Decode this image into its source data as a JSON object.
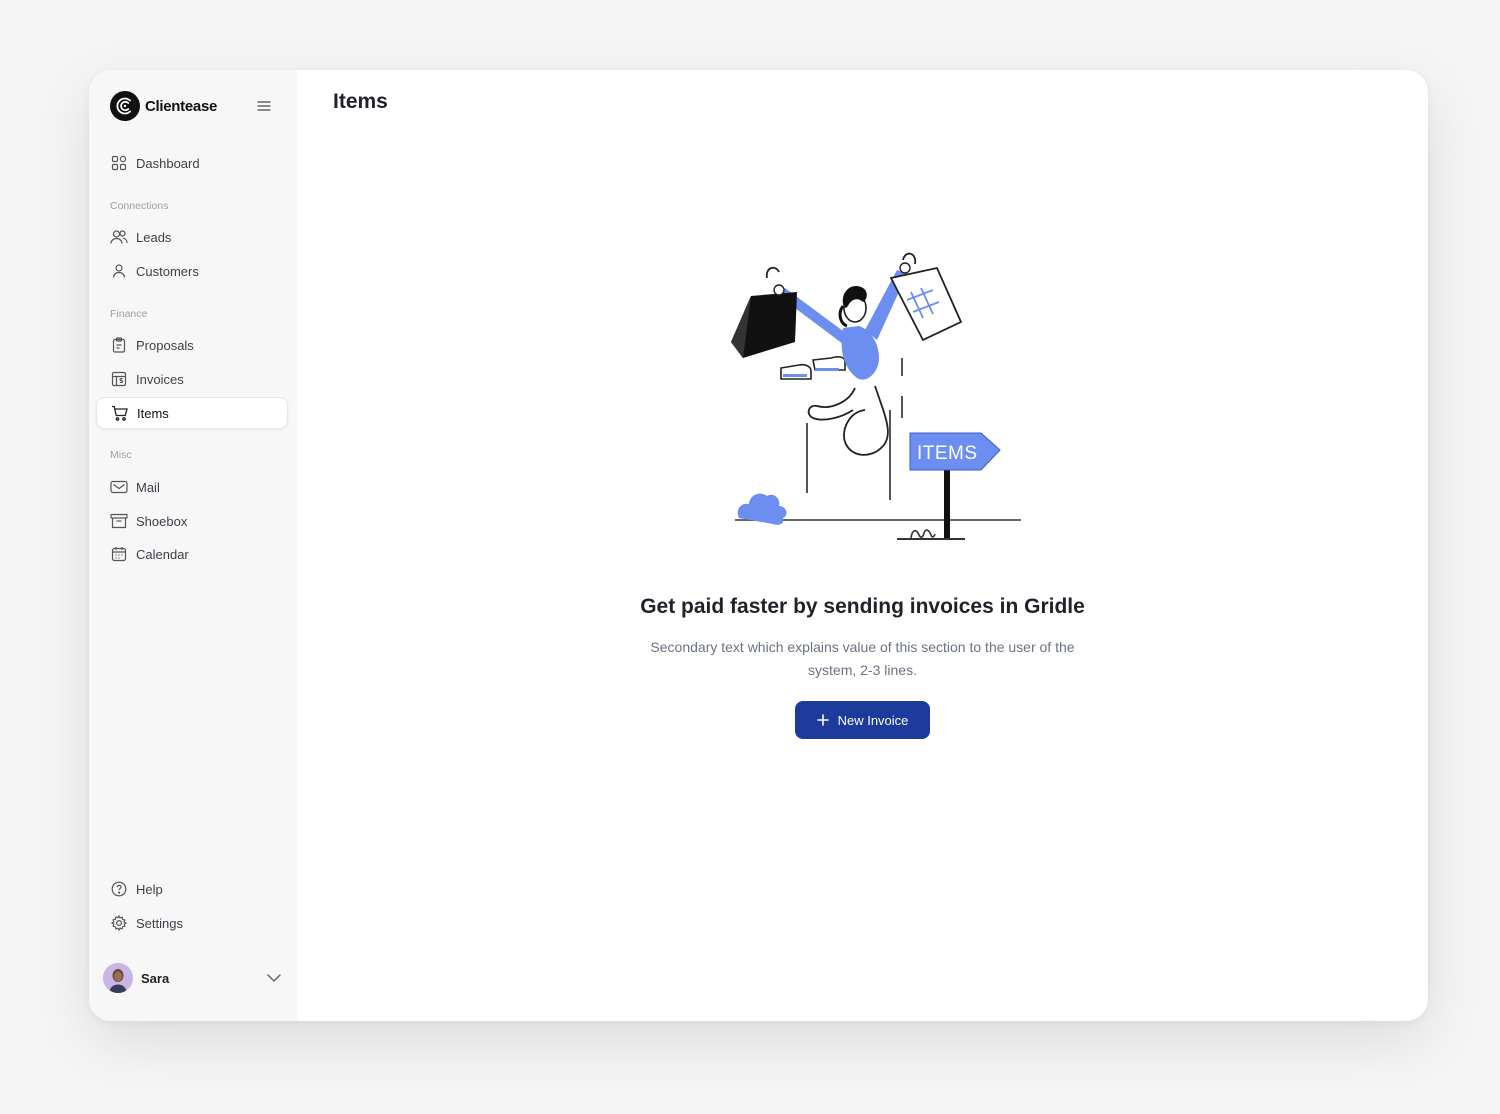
{
  "brand": {
    "name": "Clientease"
  },
  "sidebar": {
    "top_items": [
      {
        "label": "Dashboard",
        "icon": "grid-icon"
      }
    ],
    "sections": [
      {
        "label": "Connections",
        "items": [
          {
            "label": "Leads",
            "icon": "users-icon"
          },
          {
            "label": "Customers",
            "icon": "user-icon"
          }
        ]
      },
      {
        "label": "Finance",
        "items": [
          {
            "label": "Proposals",
            "icon": "clipboard-icon"
          },
          {
            "label": "Invoices",
            "icon": "invoice-icon"
          },
          {
            "label": "Items",
            "icon": "cart-icon",
            "active": true
          }
        ]
      },
      {
        "label": "Misc",
        "items": [
          {
            "label": "Mail",
            "icon": "mail-icon"
          },
          {
            "label": "Shoebox",
            "icon": "archive-icon"
          },
          {
            "label": "Calendar",
            "icon": "calendar-icon"
          }
        ]
      }
    ],
    "bottom_items": [
      {
        "label": "Help",
        "icon": "help-icon"
      },
      {
        "label": "Settings",
        "icon": "gear-icon"
      }
    ],
    "user": {
      "name": "Sara"
    }
  },
  "main": {
    "title": "Items",
    "illustration": {
      "sign_text": "ITEMS"
    },
    "empty_state": {
      "heading": "Get paid faster by sending invoices in Gridle",
      "text": "Secondary text which explains value of this section to the user of the system, 2-3 lines.",
      "button_label": "New Invoice"
    }
  },
  "colors": {
    "accent": "#1d3b9c",
    "illustration_blue": "#6b8ef0",
    "sidebar_bg": "#f7f7f7"
  }
}
